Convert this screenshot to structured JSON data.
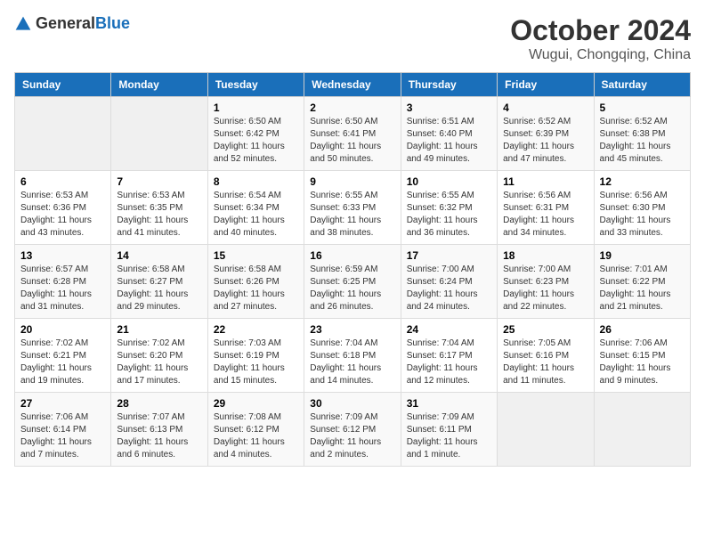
{
  "header": {
    "logo_general": "General",
    "logo_blue": "Blue",
    "month": "October 2024",
    "location": "Wugui, Chongqing, China"
  },
  "weekdays": [
    "Sunday",
    "Monday",
    "Tuesday",
    "Wednesday",
    "Thursday",
    "Friday",
    "Saturday"
  ],
  "weeks": [
    [
      {
        "day": "",
        "info": ""
      },
      {
        "day": "",
        "info": ""
      },
      {
        "day": "1",
        "info": "Sunrise: 6:50 AM\nSunset: 6:42 PM\nDaylight: 11 hours and 52 minutes."
      },
      {
        "day": "2",
        "info": "Sunrise: 6:50 AM\nSunset: 6:41 PM\nDaylight: 11 hours and 50 minutes."
      },
      {
        "day": "3",
        "info": "Sunrise: 6:51 AM\nSunset: 6:40 PM\nDaylight: 11 hours and 49 minutes."
      },
      {
        "day": "4",
        "info": "Sunrise: 6:52 AM\nSunset: 6:39 PM\nDaylight: 11 hours and 47 minutes."
      },
      {
        "day": "5",
        "info": "Sunrise: 6:52 AM\nSunset: 6:38 PM\nDaylight: 11 hours and 45 minutes."
      }
    ],
    [
      {
        "day": "6",
        "info": "Sunrise: 6:53 AM\nSunset: 6:36 PM\nDaylight: 11 hours and 43 minutes."
      },
      {
        "day": "7",
        "info": "Sunrise: 6:53 AM\nSunset: 6:35 PM\nDaylight: 11 hours and 41 minutes."
      },
      {
        "day": "8",
        "info": "Sunrise: 6:54 AM\nSunset: 6:34 PM\nDaylight: 11 hours and 40 minutes."
      },
      {
        "day": "9",
        "info": "Sunrise: 6:55 AM\nSunset: 6:33 PM\nDaylight: 11 hours and 38 minutes."
      },
      {
        "day": "10",
        "info": "Sunrise: 6:55 AM\nSunset: 6:32 PM\nDaylight: 11 hours and 36 minutes."
      },
      {
        "day": "11",
        "info": "Sunrise: 6:56 AM\nSunset: 6:31 PM\nDaylight: 11 hours and 34 minutes."
      },
      {
        "day": "12",
        "info": "Sunrise: 6:56 AM\nSunset: 6:30 PM\nDaylight: 11 hours and 33 minutes."
      }
    ],
    [
      {
        "day": "13",
        "info": "Sunrise: 6:57 AM\nSunset: 6:28 PM\nDaylight: 11 hours and 31 minutes."
      },
      {
        "day": "14",
        "info": "Sunrise: 6:58 AM\nSunset: 6:27 PM\nDaylight: 11 hours and 29 minutes."
      },
      {
        "day": "15",
        "info": "Sunrise: 6:58 AM\nSunset: 6:26 PM\nDaylight: 11 hours and 27 minutes."
      },
      {
        "day": "16",
        "info": "Sunrise: 6:59 AM\nSunset: 6:25 PM\nDaylight: 11 hours and 26 minutes."
      },
      {
        "day": "17",
        "info": "Sunrise: 7:00 AM\nSunset: 6:24 PM\nDaylight: 11 hours and 24 minutes."
      },
      {
        "day": "18",
        "info": "Sunrise: 7:00 AM\nSunset: 6:23 PM\nDaylight: 11 hours and 22 minutes."
      },
      {
        "day": "19",
        "info": "Sunrise: 7:01 AM\nSunset: 6:22 PM\nDaylight: 11 hours and 21 minutes."
      }
    ],
    [
      {
        "day": "20",
        "info": "Sunrise: 7:02 AM\nSunset: 6:21 PM\nDaylight: 11 hours and 19 minutes."
      },
      {
        "day": "21",
        "info": "Sunrise: 7:02 AM\nSunset: 6:20 PM\nDaylight: 11 hours and 17 minutes."
      },
      {
        "day": "22",
        "info": "Sunrise: 7:03 AM\nSunset: 6:19 PM\nDaylight: 11 hours and 15 minutes."
      },
      {
        "day": "23",
        "info": "Sunrise: 7:04 AM\nSunset: 6:18 PM\nDaylight: 11 hours and 14 minutes."
      },
      {
        "day": "24",
        "info": "Sunrise: 7:04 AM\nSunset: 6:17 PM\nDaylight: 11 hours and 12 minutes."
      },
      {
        "day": "25",
        "info": "Sunrise: 7:05 AM\nSunset: 6:16 PM\nDaylight: 11 hours and 11 minutes."
      },
      {
        "day": "26",
        "info": "Sunrise: 7:06 AM\nSunset: 6:15 PM\nDaylight: 11 hours and 9 minutes."
      }
    ],
    [
      {
        "day": "27",
        "info": "Sunrise: 7:06 AM\nSunset: 6:14 PM\nDaylight: 11 hours and 7 minutes."
      },
      {
        "day": "28",
        "info": "Sunrise: 7:07 AM\nSunset: 6:13 PM\nDaylight: 11 hours and 6 minutes."
      },
      {
        "day": "29",
        "info": "Sunrise: 7:08 AM\nSunset: 6:12 PM\nDaylight: 11 hours and 4 minutes."
      },
      {
        "day": "30",
        "info": "Sunrise: 7:09 AM\nSunset: 6:12 PM\nDaylight: 11 hours and 2 minutes."
      },
      {
        "day": "31",
        "info": "Sunrise: 7:09 AM\nSunset: 6:11 PM\nDaylight: 11 hours and 1 minute."
      },
      {
        "day": "",
        "info": ""
      },
      {
        "day": "",
        "info": ""
      }
    ]
  ]
}
